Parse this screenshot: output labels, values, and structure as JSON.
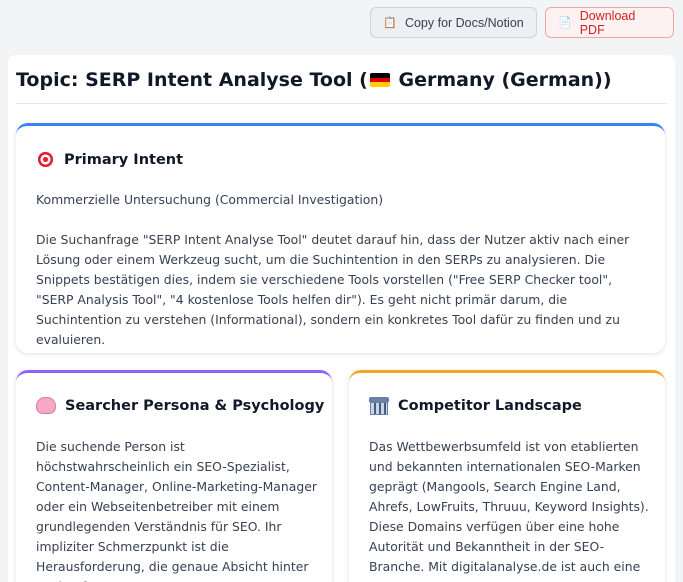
{
  "toolbar": {
    "copy_icon": "clipboard-icon",
    "copy_label": "Copy for Docs/Notion",
    "pdf_icon": "document-icon",
    "pdf_label": "Download PDF"
  },
  "topic": {
    "prefix": "Topic:",
    "title": "SERP Intent Analyse Tool",
    "region_flag": "germany-flag-icon",
    "region": "Germany (German)"
  },
  "cards": {
    "primary": {
      "icon": "target-icon",
      "title": "Primary Intent",
      "paragraphs": [
        "Kommerzielle Untersuchung (Commercial Investigation)",
        "Die Suchanfrage \"SERP Intent Analyse Tool\" deutet darauf hin, dass der Nutzer aktiv nach einer Lösung oder einem Werkzeug sucht, um die Suchintention in den SERPs zu analysieren. Die Snippets bestätigen dies, indem sie verschiedene Tools vorstellen (\"Free SERP Checker tool\", \"SERP Analysis Tool\", \"4 kostenlose Tools helfen dir\"). Es geht nicht primär darum, die Suchintention zu verstehen (Informational), sondern ein konkretes Tool dafür zu finden und zu evaluieren."
      ],
      "accent": "#3b82f6"
    },
    "persona": {
      "icon": "brain-icon",
      "title": "Searcher Persona & Psychology",
      "text": "Die suchende Person ist höchstwahrscheinlich ein SEO-Spezialist, Content-Manager, Online-Marketing-Manager oder ein Webseitenbetreiber mit einem grundlegenden Verständnis für SEO. Ihr impliziter Schmerzpunkt ist die Herausforderung, die genaue Absicht hinter Suchanfragen zu",
      "accent": "#9061f9"
    },
    "competitor": {
      "icon": "stadium-icon",
      "title": "Competitor Landscape",
      "text": "Das Wettbewerbsumfeld ist von etablierten und bekannten internationalen SEO-Marken geprägt (Mangools, Search Engine Land, Ahrefs, LowFruits, Thruuu, Keyword Insights). Diese Domains verfügen über eine hohe Autorität und Bekanntheit in der SEO-Branche. Mit digitalanalyse.de ist auch eine",
      "accent": "#f5a623"
    }
  }
}
